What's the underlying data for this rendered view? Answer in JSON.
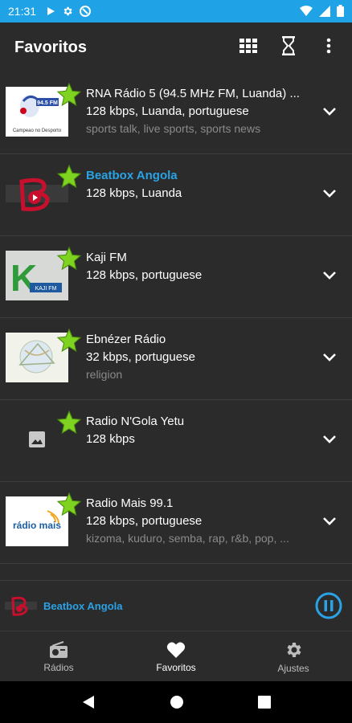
{
  "status": {
    "time": "21:31"
  },
  "appbar": {
    "title": "Favoritos"
  },
  "stations": [
    {
      "name": "RNA Rádio 5 (94.5 MHz FM, Luanda) ...",
      "meta": "128 kbps, Luanda, portuguese",
      "tags": "sports talk, live sports, sports news",
      "highlight": false,
      "logo": "rna-radio5"
    },
    {
      "name": "Beatbox Angola",
      "meta": "128 kbps, Luanda",
      "tags": "",
      "highlight": true,
      "logo": "beatbox"
    },
    {
      "name": "Kaji FM",
      "meta": "128 kbps, portuguese",
      "tags": "",
      "highlight": false,
      "logo": "kaji"
    },
    {
      "name": "Ebnézer Rádio",
      "meta": "32 kbps, portuguese",
      "tags": "religion",
      "highlight": false,
      "logo": "ebnezer"
    },
    {
      "name": "Radio N'Gola Yetu",
      "meta": "128 kbps",
      "tags": "",
      "highlight": false,
      "logo": "placeholder"
    },
    {
      "name": "Radio Mais 99.1",
      "meta": "128 kbps, portuguese",
      "tags": "kizoma, kuduro, semba, rap, r&b, pop, ...",
      "highlight": false,
      "logo": "radiomais"
    }
  ],
  "player": {
    "station": "Beatbox Angola"
  },
  "nav": {
    "radios": "Rádios",
    "favoritos": "Favoritos",
    "ajustes": "Ajustes"
  },
  "logo_text": {
    "rna_freq": "94.5 FM",
    "rna_bottom": "Campeao no Desporto",
    "kaji_big": "K",
    "kaji_small": "KAJI FM",
    "radiomais": "rádio mais"
  },
  "colors": {
    "accent": "#2aa2e5",
    "statusbar": "#1fa3e6",
    "star": "#7ed321"
  }
}
